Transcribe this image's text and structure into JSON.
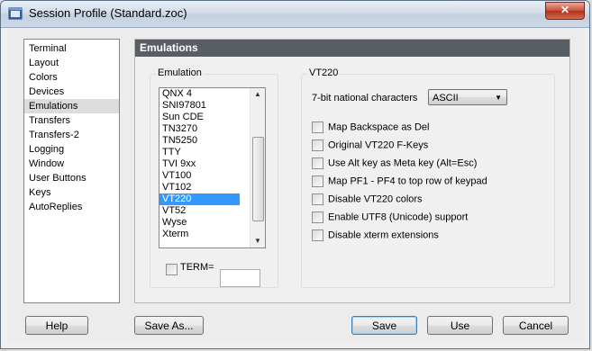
{
  "window": {
    "title": "Session Profile (Standard.zoc)",
    "close_glyph": "✕"
  },
  "nav": {
    "items": [
      "Terminal",
      "Layout",
      "Colors",
      "Devices",
      "Emulations",
      "Transfers",
      "Transfers-2",
      "Logging",
      "Window",
      "User Buttons",
      "Keys",
      "AutoReplies"
    ],
    "selected": "Emulations"
  },
  "panel": {
    "title": "Emulations"
  },
  "emulation": {
    "group_label": "Emulation",
    "items": [
      "QNX 4",
      "SNI97801",
      "Sun CDE",
      "TN3270",
      "TN5250",
      "TTY",
      "TVI 9xx",
      "VT100",
      "VT102",
      "VT220",
      "VT52",
      "Wyse",
      "Xterm"
    ],
    "selected": "VT220",
    "term_label": "TERM=",
    "term_value": ""
  },
  "vt220": {
    "group_label": "VT220",
    "national_label": "7-bit national characters",
    "national_value": "ASCII",
    "options": [
      "Map Backspace as Del",
      "Original VT220 F-Keys",
      "Use Alt key as Meta key (Alt=Esc)",
      "Map PF1 - PF4 to top row of keypad",
      "Disable VT220 colors",
      "Enable UTF8 (Unicode) support",
      "Disable xterm extensions"
    ]
  },
  "buttons": {
    "help": "Help",
    "save_as": "Save As...",
    "save": "Save",
    "use": "Use",
    "cancel": "Cancel"
  }
}
